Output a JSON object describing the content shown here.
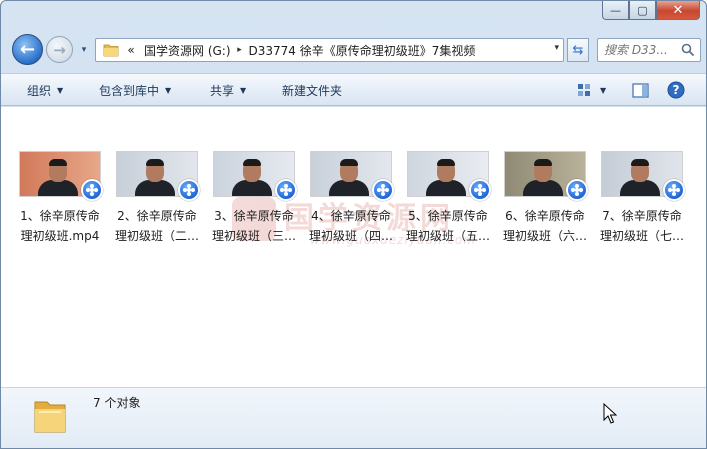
{
  "window": {
    "controls": {
      "minimize": "—",
      "maximize": "▢",
      "close": "✕"
    }
  },
  "nav": {
    "back_icon": "arrow-left-icon",
    "forward_icon": "arrow-right-icon",
    "history_caret": "▾"
  },
  "address": {
    "overflow": "«",
    "crumbs": [
      "国学资源网 (G:)",
      "D33774  徐辛《原传命理初级班》7集视频"
    ],
    "dropdown": "▾"
  },
  "refresh_icon": "⇆",
  "search": {
    "placeholder": "搜索 D33..."
  },
  "toolbar": {
    "organize": "组织",
    "include_library": "包含到库中",
    "share": "共享",
    "new_folder": "新建文件夹"
  },
  "files": [
    {
      "line1": "1、徐辛原传命",
      "line2": "理初级班.mp4",
      "bg": "#d1795a",
      "accent": "#e7a889"
    },
    {
      "line1": "2、徐辛原传命",
      "line2": "理初级班（二…",
      "bg": "#c7cfd9",
      "accent": "#e2e6ec"
    },
    {
      "line1": "3、徐辛原传命",
      "line2": "理初级班（三…",
      "bg": "#cbd3dd",
      "accent": "#e6eaf0"
    },
    {
      "line1": "4、徐辛原传命",
      "line2": "理初级班（四…",
      "bg": "#c8d0da",
      "accent": "#e4e8ee"
    },
    {
      "line1": "5、徐辛原传命",
      "line2": "理初级班（五…",
      "bg": "#cfd6df",
      "accent": "#e9ecf1"
    },
    {
      "line1": "6、徐辛原传命",
      "line2": "理初级班（六…",
      "bg": "#8f8a74",
      "accent": "#b9b29a"
    },
    {
      "line1": "7、徐辛原传命",
      "line2": "理初级班（七…",
      "bg": "#c4ccd6",
      "accent": "#e1e5eb"
    }
  ],
  "watermark": {
    "text": "国学资源网",
    "url": "www.guoxueziyuan.com"
  },
  "status": {
    "count": "7 个对象"
  }
}
